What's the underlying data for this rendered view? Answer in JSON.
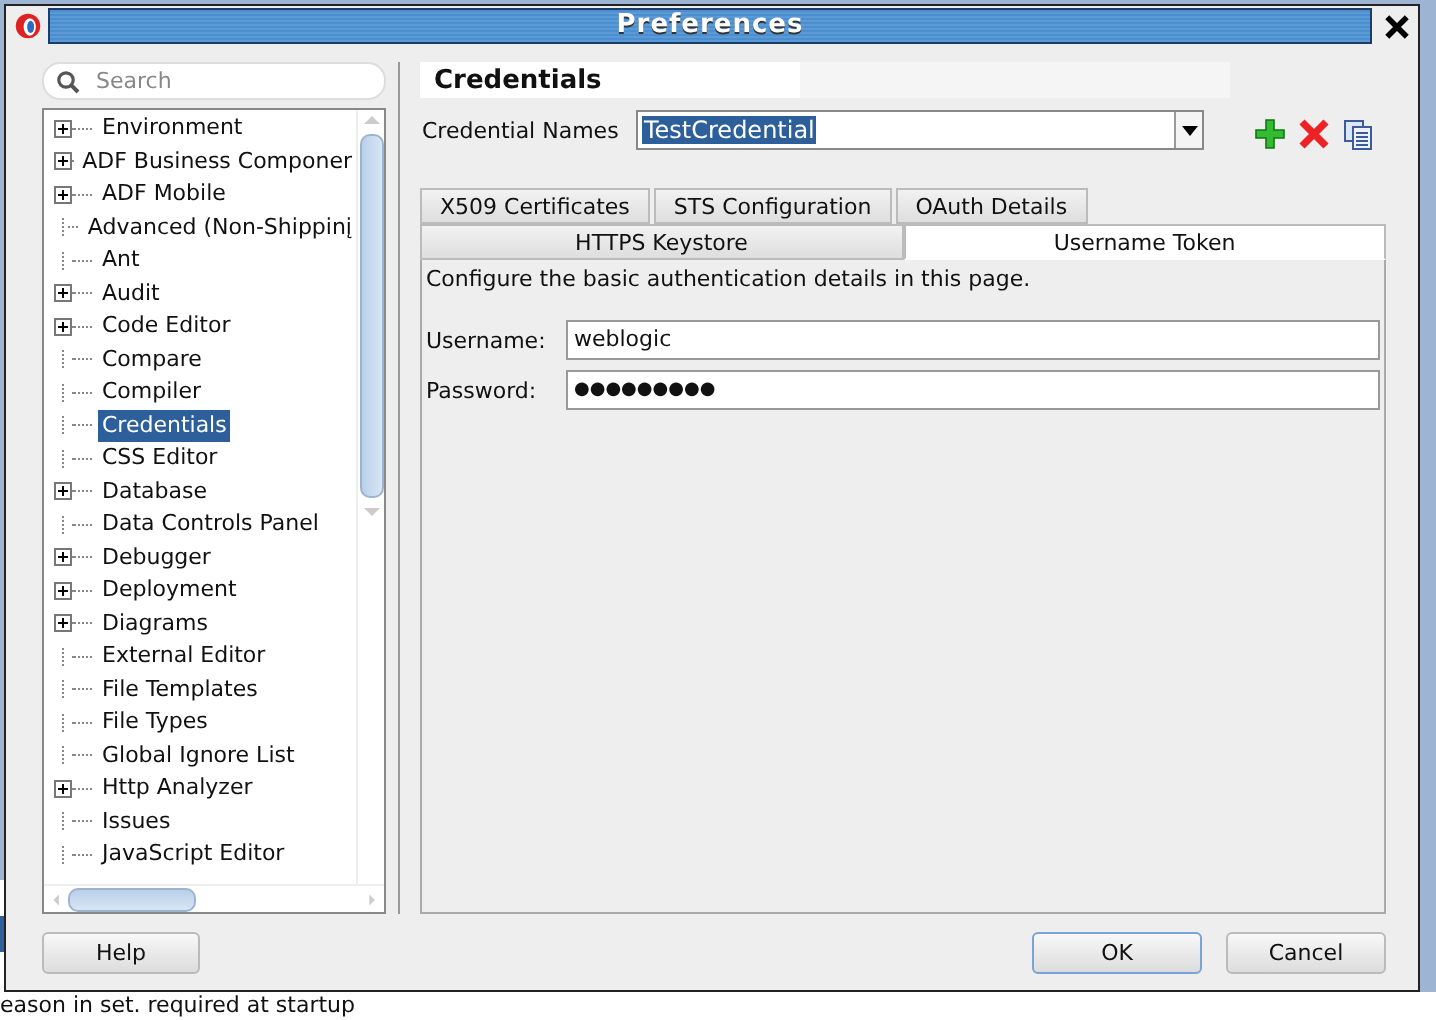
{
  "background": {
    "footer": "eason in set. required at startup"
  },
  "window": {
    "title": "Preferences"
  },
  "search": {
    "placeholder": "Search"
  },
  "tree": [
    {
      "label": "Environment",
      "expandable": true,
      "selected": false
    },
    {
      "label": "ADF Business Componer",
      "expandable": true,
      "selected": false
    },
    {
      "label": "ADF Mobile",
      "expandable": true,
      "selected": false
    },
    {
      "label": "Advanced (Non-Shippinį",
      "expandable": false,
      "selected": false
    },
    {
      "label": "Ant",
      "expandable": false,
      "selected": false
    },
    {
      "label": "Audit",
      "expandable": true,
      "selected": false
    },
    {
      "label": "Code Editor",
      "expandable": true,
      "selected": false
    },
    {
      "label": "Compare",
      "expandable": false,
      "selected": false
    },
    {
      "label": "Compiler",
      "expandable": false,
      "selected": false
    },
    {
      "label": "Credentials",
      "expandable": false,
      "selected": true
    },
    {
      "label": "CSS Editor",
      "expandable": false,
      "selected": false
    },
    {
      "label": "Database",
      "expandable": true,
      "selected": false
    },
    {
      "label": "Data Controls Panel",
      "expandable": false,
      "selected": false
    },
    {
      "label": "Debugger",
      "expandable": true,
      "selected": false
    },
    {
      "label": "Deployment",
      "expandable": true,
      "selected": false
    },
    {
      "label": "Diagrams",
      "expandable": true,
      "selected": false
    },
    {
      "label": "External Editor",
      "expandable": false,
      "selected": false
    },
    {
      "label": "File Templates",
      "expandable": false,
      "selected": false
    },
    {
      "label": "File Types",
      "expandable": false,
      "selected": false
    },
    {
      "label": "Global Ignore List",
      "expandable": false,
      "selected": false
    },
    {
      "label": "Http Analyzer",
      "expandable": true,
      "selected": false
    },
    {
      "label": "Issues",
      "expandable": false,
      "selected": false
    },
    {
      "label": "JavaScript Editor",
      "expandable": false,
      "selected": false
    }
  ],
  "panel": {
    "title": "Credentials",
    "credential_names": {
      "label": "Credential Names",
      "value": "TestCredential"
    },
    "tabs_row_1": [
      {
        "label": "X509 Certificates",
        "selected": false
      },
      {
        "label": "STS Configuration",
        "selected": false
      },
      {
        "label": "OAuth Details",
        "selected": false
      }
    ],
    "tabs_row_2": [
      {
        "label": "HTTPS Keystore",
        "selected": false
      },
      {
        "label": "Username Token",
        "selected": true
      }
    ],
    "description": "Configure the basic authentication details in this page.",
    "fields": [
      {
        "label": "Username:",
        "value": "weblogic",
        "kind": "text"
      },
      {
        "label": "Password:",
        "value": "●●●●●●●●●",
        "kind": "password"
      }
    ]
  },
  "buttons": {
    "help": "Help",
    "ok": "OK",
    "cancel": "Cancel"
  }
}
